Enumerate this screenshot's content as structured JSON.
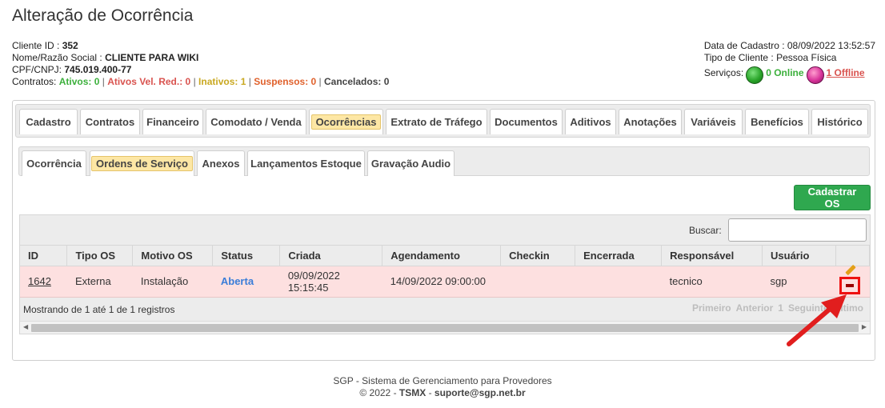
{
  "page_title": "Alteração de Ocorrência",
  "client": {
    "id_label": "Cliente ID : ",
    "id_value": "352",
    "name_label": "Nome/Razão Social : ",
    "name_value": "CLIENTE PARA WIKI",
    "cpf_label": "CPF/CNPJ: ",
    "cpf_value": "745.019.400-77",
    "contracts_label": "Contratos: ",
    "ativos": "Ativos: 0",
    "ativos_vel": "Ativos Vel. Red.: 0",
    "inativos": "Inativos: 1",
    "suspensos": "Suspensos: 0",
    "cancelados": "Cancelados: 0",
    "sep": " | "
  },
  "client_right": {
    "data_cadastro": "Data de Cadastro : 08/09/2022 13:52:57",
    "tipo_cliente": "Tipo de Cliente : Pessoa Física",
    "servicos_label": "Serviços:",
    "online": "0 Online",
    "offline": "1 Offline"
  },
  "main_tabs": [
    {
      "label": "Cadastro"
    },
    {
      "label": "Contratos"
    },
    {
      "label": "Financeiro"
    },
    {
      "label": "Comodato / Venda"
    },
    {
      "label": "Ocorrências"
    },
    {
      "label": "Extrato de Tráfego"
    },
    {
      "label": "Documentos"
    },
    {
      "label": "Aditivos"
    },
    {
      "label": "Anotações"
    },
    {
      "label": "Variáveis"
    },
    {
      "label": "Benefícios"
    },
    {
      "label": "Histórico"
    }
  ],
  "sub_tabs": [
    {
      "label": "Ocorrência"
    },
    {
      "label": "Ordens de Serviço"
    },
    {
      "label": "Anexos"
    },
    {
      "label": "Lançamentos Estoque"
    },
    {
      "label": "Gravação Audio"
    }
  ],
  "cadastrar_os": "Cadastrar OS",
  "search_label": "Buscar:",
  "table": {
    "headers": [
      "ID",
      "Tipo OS",
      "Motivo OS",
      "Status",
      "Criada",
      "Agendamento",
      "Checkin",
      "Encerrada",
      "Responsável",
      "Usuário"
    ],
    "row": {
      "id": "1642",
      "tipo": "Externa",
      "motivo": "Instalação",
      "status": "Aberta",
      "criada_date": "09/09/2022",
      "criada_time": "15:15:45",
      "agendamento": "14/09/2022 09:00:00",
      "checkin": "",
      "encerrada": "",
      "responsavel": "tecnico",
      "usuario": "sgp"
    },
    "showing": "Mostrando de 1 até 1 de 1 registros",
    "pager": {
      "first": "Primeiro",
      "prev": "Anterior",
      "page": "1",
      "next": "Seguinte",
      "last": "Último"
    }
  },
  "footer": {
    "line1": "SGP - Sistema de Gerenciamento para Provedores",
    "copyright": "© 2022 - ",
    "company": "TSMX",
    "dash": " - ",
    "email": "suporte@sgp.net.br"
  },
  "colors": {
    "highlight": "#fde7a5",
    "row": "#fde0e0",
    "button": "#2fa84f",
    "arrow": "#e11e1e"
  }
}
